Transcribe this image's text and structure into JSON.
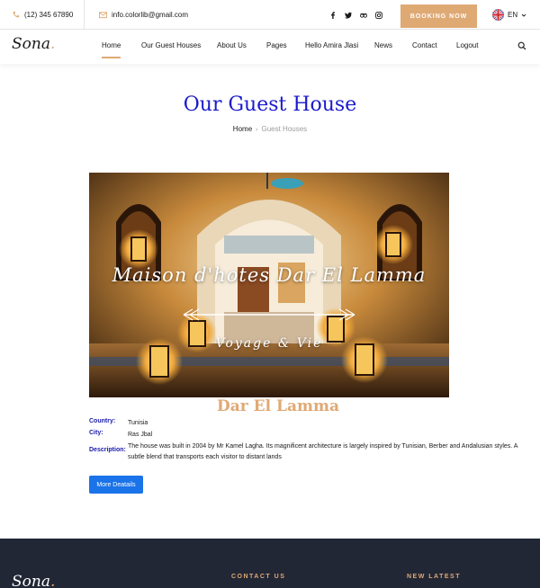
{
  "topbar": {
    "phone": "(12) 345 67890",
    "email": "info.colorlib@gmail.com",
    "socials": [
      "facebook-icon",
      "twitter-icon",
      "tripadvisor-icon",
      "instagram-icon"
    ],
    "booking_label": "BOOKING NOW",
    "language": "EN"
  },
  "nav": {
    "logo": "Sona",
    "items": [
      "Home",
      "Our Guest Houses",
      "About Us",
      "Pages",
      "Hello Amira Jlasi",
      "News",
      "Contact",
      "Logout"
    ],
    "active": "Home"
  },
  "page": {
    "title": "Our Guest House",
    "breadcrumb": {
      "home": "Home",
      "current": "Guest Houses"
    }
  },
  "house": {
    "image_title": "Maison d'hotes Dar El Lamma",
    "image_subtitle": "Voyage & Vie",
    "name": "Dar El Lamma",
    "country_label": "Country:",
    "country": "Tunisia",
    "city_label": "City:",
    "city": "Ras Jbal",
    "description_label": "Description:",
    "description": "The house was built in 2004 by Mr Kamel Lagha. Its magnificent architecture is largely inspired by Tunisian, Berber and Andalusian styles. A subtle blend that transports each visitor to distant lands",
    "button": "More Deatails"
  },
  "footer": {
    "logo": "Sona",
    "contact_heading": "CONTACT US",
    "news_heading": "NEW LATEST"
  },
  "colors": {
    "accent": "#dfa974",
    "title": "#1a1acc",
    "button": "#1a73e8",
    "footer": "#222736"
  }
}
